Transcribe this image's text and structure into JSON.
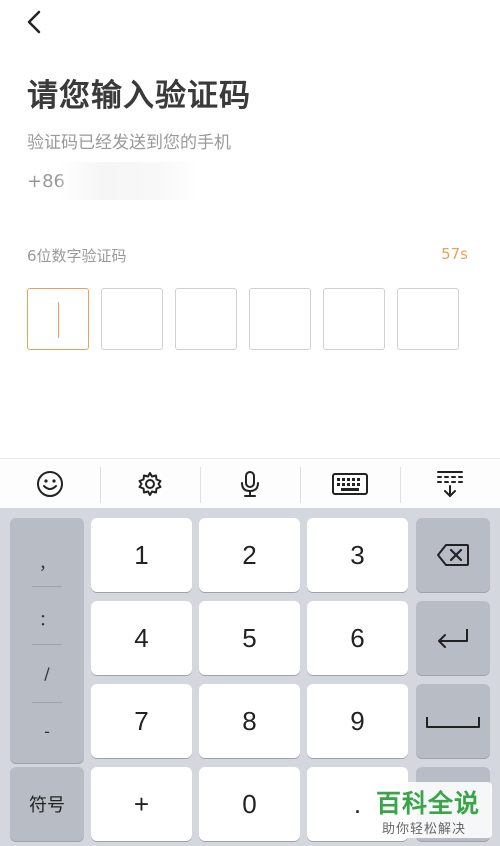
{
  "header": {
    "title": "请您输入验证码",
    "subtitle": "验证码已经发送到您的手机",
    "phone_prefix": "+86"
  },
  "code": {
    "label": "6位数字验证码",
    "countdown": "57s",
    "box_count": 6
  },
  "toolbar": {
    "items": [
      "emoji-icon",
      "gear-icon",
      "microphone-icon",
      "keyboard-icon",
      "collapse-keyboard-icon"
    ]
  },
  "keyboard": {
    "symbols": [
      "，",
      "：",
      "/",
      "-"
    ],
    "symbol_switch": "符号",
    "keys": {
      "k1": "1",
      "k2": "2",
      "k3": "3",
      "k4": "4",
      "k5": "5",
      "k6": "6",
      "k7": "7",
      "k8": "8",
      "k9": "9",
      "plus": "+",
      "k0": "0",
      "dot": "."
    }
  },
  "watermark": {
    "title": "百科全说",
    "subtitle": "助你轻松解决"
  },
  "colors": {
    "accent": "#e8a25c",
    "keyboard_bg": "#d4d7dd",
    "watermark": "#3aa548"
  }
}
